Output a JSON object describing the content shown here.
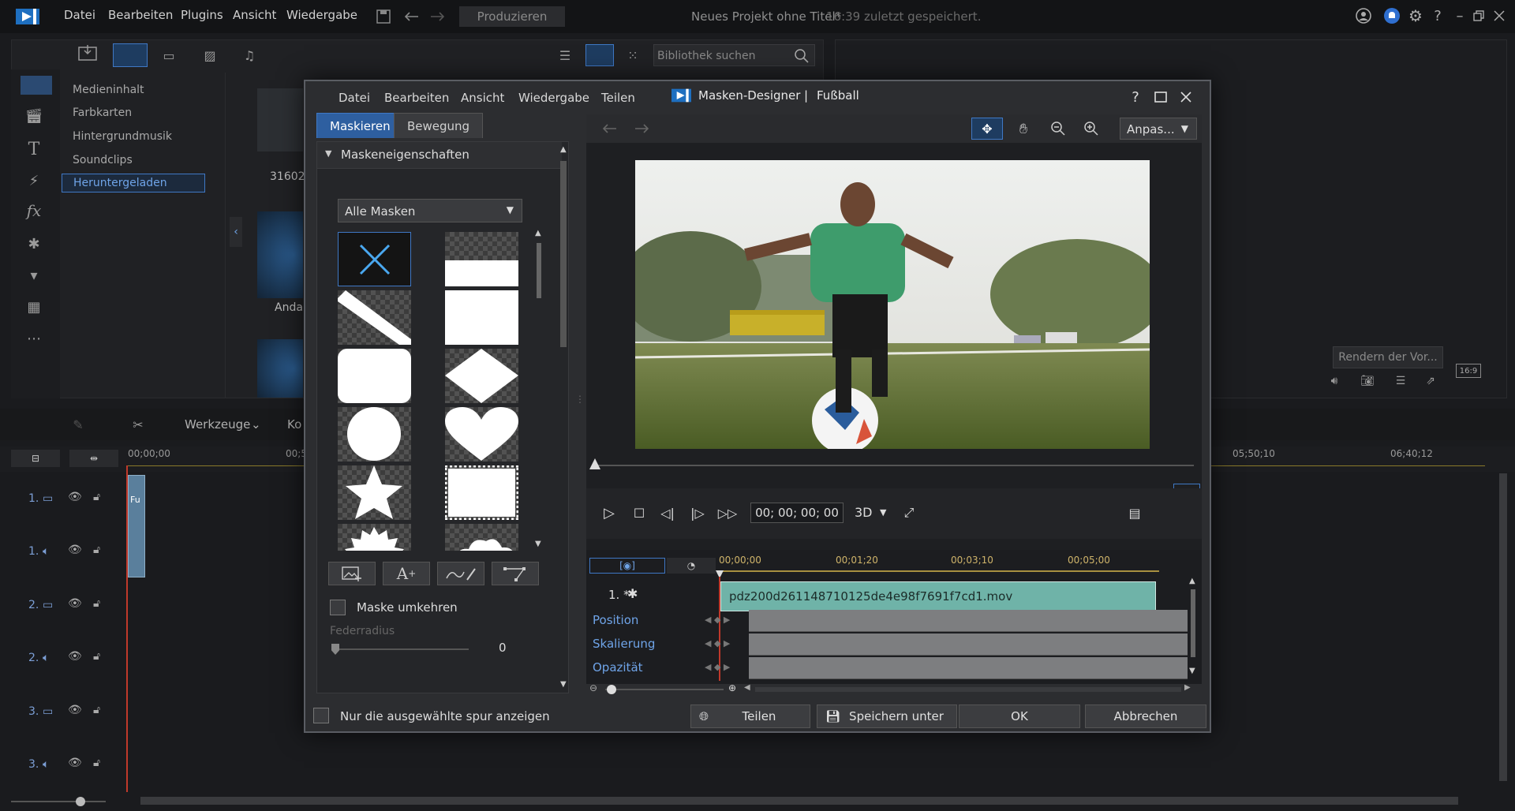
{
  "app": {
    "menu": [
      "Datei",
      "Bearbeiten",
      "Plugins",
      "Ansicht",
      "Wiedergabe"
    ],
    "produce_label": "Produzieren",
    "project_title": "Neues Projekt ohne Titel*",
    "saved_time": "16:39 zuletzt gespeichert."
  },
  "library": {
    "search_placeholder": "Bibliothek suchen",
    "items": [
      "Medieninhalt",
      "Farbkarten",
      "Hintergrundmusik",
      "Soundclips",
      "Heruntergeladen"
    ],
    "selected_index": 4,
    "thumb_labels": [
      "31602...",
      "Anda..."
    ]
  },
  "preview": {
    "render_label": "Rendern der Vor...",
    "ratio_label": "16:9"
  },
  "timeline": {
    "werkzeuge_label": "Werkzeuge",
    "ko_label": "Ko",
    "ruler_start": "00;00;00",
    "ruler_mid": "00;5",
    "ruler_t1": "05;50;10",
    "ruler_t2": "06;40;12",
    "tracks": [
      {
        "num": "1.",
        "type": "video"
      },
      {
        "num": "1.",
        "type": "audio"
      },
      {
        "num": "2.",
        "type": "video"
      },
      {
        "num": "2.",
        "type": "audio"
      },
      {
        "num": "3.",
        "type": "video"
      },
      {
        "num": "3.",
        "type": "audio"
      }
    ],
    "clip_label": "Fu"
  },
  "dialog": {
    "menu": [
      "Datei",
      "Bearbeiten",
      "Ansicht",
      "Wiedergabe",
      "Teilen"
    ],
    "title": "Masken-Designer",
    "subtitle": "Fußball",
    "tabs": [
      "Maskieren",
      "Bewegung"
    ],
    "section_title": "Maskeneigenschaften",
    "mask_filter": "Alle Masken",
    "invert_label": "Maske umkehren",
    "feather_label": "Federradius",
    "feather_value": "0",
    "feather_level": 0,
    "zoom_fit": "Anpas...",
    "timecode": "00; 00; 00; 00",
    "mode_3d": "3D",
    "kf_ruler": [
      "00;00;00",
      "00;01;20",
      "00;03;10",
      "00;05;00"
    ],
    "clip_track_label": "1. *",
    "clip_name": "pdz200d261148710125de4e98f7691f7cd1.mov",
    "keyframe_rows": [
      "Position",
      "Skalierung",
      "Opazität"
    ],
    "only_selected_label": "Nur die ausgewählte spur anzeigen",
    "share_label": "Teilen",
    "save_as_label": "Speichern unter",
    "ok_label": "OK",
    "cancel_label": "Abbrechen"
  },
  "colors": {
    "accent": "#3f8fe0",
    "clip": "#6fb3a8",
    "kf_label": "#6fa4e8"
  }
}
